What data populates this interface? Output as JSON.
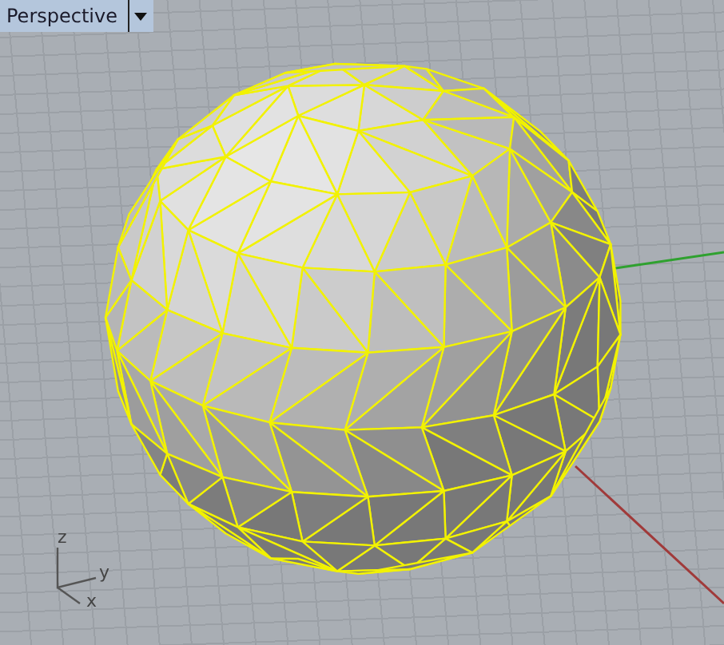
{
  "viewport": {
    "title": "Perspective",
    "axes": [
      {
        "label": "z"
      },
      {
        "label": "y"
      },
      {
        "label": "x"
      }
    ]
  }
}
